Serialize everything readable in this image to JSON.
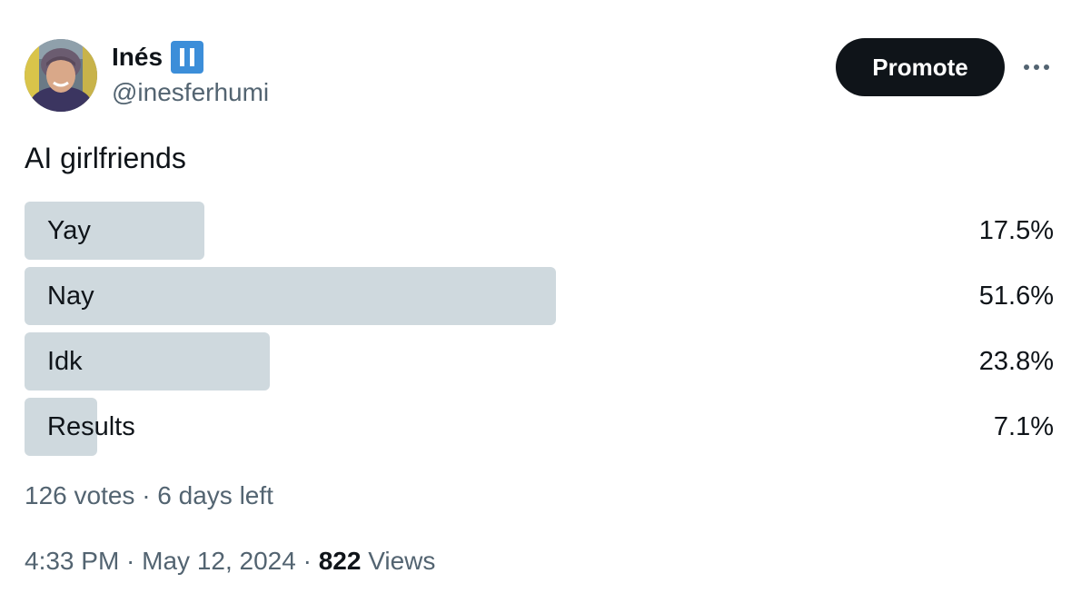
{
  "author": {
    "name": "Inés",
    "handle": "@inesferhumi",
    "badge_icon": "pause-icon",
    "badge_color": "#3c8ed9"
  },
  "header": {
    "promote_label": "Promote",
    "more_icon": "ellipsis-icon"
  },
  "tweet": {
    "text": "AI girlfriends"
  },
  "poll": {
    "options": [
      {
        "label": "Yay",
        "percent_text": "17.5%",
        "percent": 17.5
      },
      {
        "label": "Nay",
        "percent_text": "51.6%",
        "percent": 51.6
      },
      {
        "label": "Idk",
        "percent_text": "23.8%",
        "percent": 23.8
      },
      {
        "label": "Results",
        "percent_text": "7.1%",
        "percent": 7.1
      }
    ],
    "meta": "126 votes · 6 days left"
  },
  "footer": {
    "time": "4:33 PM · May 12, 2024 · ",
    "views_count": "822",
    "views_label": " Views"
  },
  "colors": {
    "text_primary": "#0f1419",
    "text_secondary": "#536471",
    "bar": "#cfd9de",
    "button_bg": "#0f1419"
  }
}
